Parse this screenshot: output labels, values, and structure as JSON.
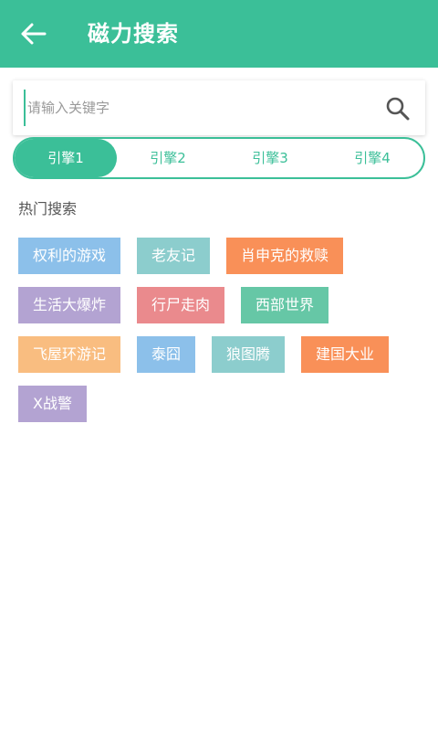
{
  "header": {
    "title": "磁力搜索",
    "background": "#3bbf98"
  },
  "search": {
    "placeholder": "请输入关键字",
    "value": ""
  },
  "engines": [
    {
      "label": "引擎1",
      "active": true
    },
    {
      "label": "引擎2",
      "active": false
    },
    {
      "label": "引擎3",
      "active": false
    },
    {
      "label": "引擎4",
      "active": false
    }
  ],
  "hot": {
    "title": "热门搜索",
    "tags": [
      {
        "label": "权利的游戏",
        "color": "#8cc0ea"
      },
      {
        "label": "老友记",
        "color": "#8ccdcd"
      },
      {
        "label": "肖申克的救赎",
        "color": "#f99058"
      },
      {
        "label": "生活大爆炸",
        "color": "#b3a3d2"
      },
      {
        "label": "行尸走肉",
        "color": "#ea8a8d"
      },
      {
        "label": "西部世界",
        "color": "#66c7a6"
      },
      {
        "label": "飞屋环游记",
        "color": "#f9bd80"
      },
      {
        "label": "泰囧",
        "color": "#8cc0ea"
      },
      {
        "label": "狼图腾",
        "color": "#8ccdcd"
      },
      {
        "label": "建国大业",
        "color": "#f99058"
      },
      {
        "label": "X战警",
        "color": "#b3a3d2"
      }
    ]
  },
  "icons": {
    "back": "arrow-left-icon",
    "search": "magnifier-icon"
  }
}
